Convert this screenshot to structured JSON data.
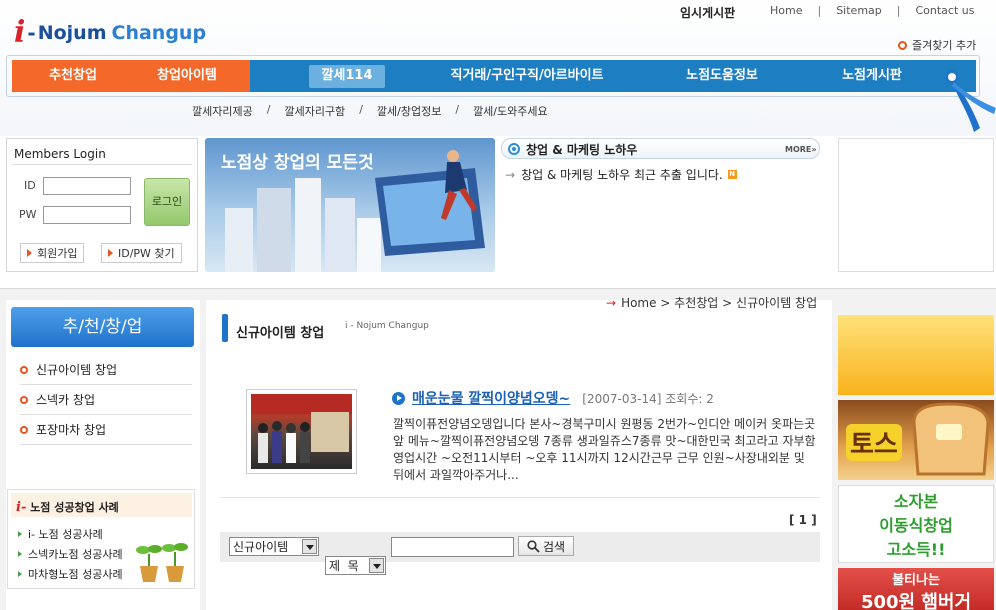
{
  "logo": {
    "i": "i",
    "dash": "-",
    "nojum": "Nojum",
    "changup": "Changup"
  },
  "header": {
    "board_label": "임시게시판",
    "links": [
      "Home",
      "Sitemap",
      "Contact us"
    ],
    "separator": "|",
    "favorites": "즐겨찾기 추가"
  },
  "nav": {
    "items": [
      "추천창업",
      "창업아이템",
      "깔세114",
      "직거래/구인구직/아르바이트",
      "노점도움정보",
      "노점게시판"
    ],
    "active": "깔세114"
  },
  "subnav": {
    "items": [
      "깔세자리제공",
      "깔세자리구함",
      "깔세/창업정보",
      "깔세/도와주세요"
    ],
    "separator": "/"
  },
  "login": {
    "title": "Members Login",
    "id_label": "ID",
    "pw_label": "PW",
    "id_value": "",
    "pw_value": "",
    "login_button": "로그인",
    "join_button": "회원가입",
    "find_button": "ID/PW 찾기"
  },
  "banner": {
    "text": "노점상 창업의 모든것"
  },
  "marketing": {
    "title": "창업 & 마케팅 노하우",
    "more": "MORE»",
    "item": "창업 & 마케팅 노하우 최근 추출 입니다.",
    "new_badge": "N"
  },
  "left_menu": {
    "header": "추/천/창/업",
    "items": [
      "신규아이템 창업",
      "스넥카 창업",
      "포장마차 창업"
    ]
  },
  "success": {
    "title_prefix": "i-",
    "title": "노점 성공창업 사례",
    "items": [
      "i- 노점 성공사례",
      "스넥카노점 성공사례",
      "마차형노점 성공사례"
    ]
  },
  "breadcrumb": {
    "arrow": "→",
    "path": "Home > 추천창업 > 신규아이템 창업"
  },
  "page": {
    "title": "신규아이템 창업",
    "logo_text": "i - Nojum Changup"
  },
  "post": {
    "title": "매운눈물 깔찍이양념오뎅~",
    "date": "[2007-03-14]",
    "views_label": "조회수: 2",
    "body": "깔찍이퓨전양념오뎅입니다 본사~경북구미시 원평동 2번가~인디안 메이커 옷파는곳앞 메뉴~깔찍이퓨전양념오뎅 7종류 생과일쥬스7종류 맛~대한민국 최고라고 자부함 영업시간 ~오전11시부터 ~오후 11시까지 12시간근무 근무 인원~사장내외분 및 뒤에서 과일깍아주거나..."
  },
  "pagination": {
    "text": "[ 1 ]"
  },
  "search": {
    "category": "신규아이템",
    "field": "제  목",
    "query": "",
    "button": "검색"
  },
  "ads": {
    "toast": "토스",
    "small_capital": [
      "소자본",
      "이동식창업",
      "고소득!!"
    ],
    "burger": [
      "불티나는",
      "500원 햄버거"
    ]
  },
  "colors": {
    "nav_blue": "#1e7ec2",
    "nav_orange": "#f4692a",
    "accent_red": "#d8232a",
    "link_blue": "#1a62b8"
  }
}
